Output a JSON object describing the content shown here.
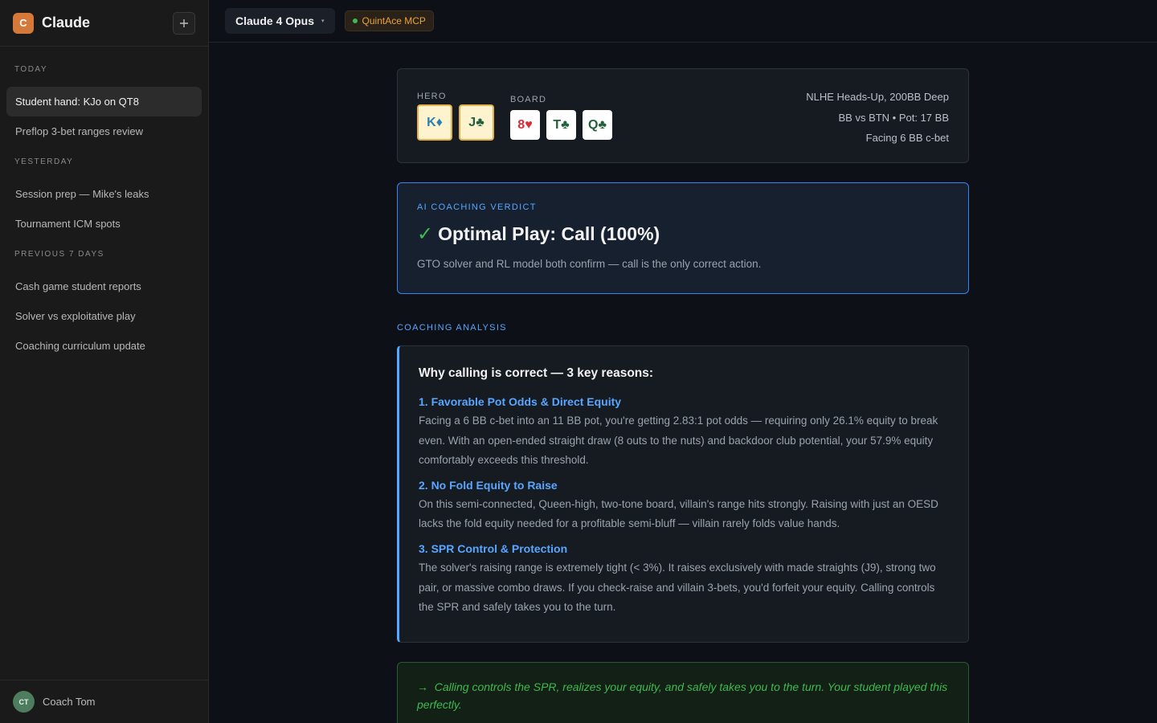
{
  "app": {
    "logo_letter": "C",
    "name": "Claude",
    "new_chat_icon": "plus-icon"
  },
  "sidebar": {
    "sections": [
      {
        "label": "TODAY",
        "items": [
          "Student hand: KJo on QT8",
          "Preflop 3-bet ranges review"
        ]
      },
      {
        "label": "YESTERDAY",
        "items": [
          "Session prep — Mike's leaks",
          "Tournament ICM spots"
        ]
      },
      {
        "label": "PREVIOUS 7 DAYS",
        "items": [
          "Cash game student reports",
          "Solver vs exploitative play",
          "Coaching curriculum update"
        ]
      }
    ],
    "active_item": "Student hand: KJo on QT8",
    "user": {
      "initials": "CT",
      "name": "Coach Tom"
    }
  },
  "topbar": {
    "model": "Claude 4 Opus",
    "caret": "▾",
    "mcp_badge": "QuintAce MCP",
    "mcp_status_color": "#3fb950"
  },
  "hand": {
    "hero_label": "HERO",
    "hero_cards": [
      {
        "rank": "K",
        "suit": "♦"
      },
      {
        "rank": "J",
        "suit": "♣"
      }
    ],
    "board_label": "BOARD",
    "board_cards": [
      {
        "rank": "8",
        "suit": "♥"
      },
      {
        "rank": "T",
        "suit": "♣"
      },
      {
        "rank": "Q",
        "suit": "♣"
      }
    ],
    "info": [
      "NLHE Heads-Up, 200BB Deep",
      "BB vs BTN • Pot: 17 BB",
      "Facing 6 BB c-bet"
    ]
  },
  "verdict": {
    "label": "AI COACHING VERDICT",
    "check": "✓",
    "title": "Optimal Play: Call (100%)",
    "subtitle": "GTO solver and RL model both confirm — call is the only correct action."
  },
  "analysis": {
    "section_label": "COACHING ANALYSIS",
    "heading": "Why calling is correct — 3 key reasons:",
    "reasons": [
      {
        "title": "1. Favorable Pot Odds & Direct Equity",
        "body": "Facing a 6 BB c-bet into an 11 BB pot, you're getting 2.83:1 pot odds — requiring only 26.1% equity to break even. With an open-ended straight draw (8 outs to the nuts) and backdoor club potential, your 57.9% equity comfortably exceeds this threshold."
      },
      {
        "title": "2. No Fold Equity to Raise",
        "body": "On this semi-connected, Queen-high, two-tone board, villain's range hits strongly. Raising with just an OESD lacks the fold equity needed for a profitable semi-bluff — villain rarely folds value hands."
      },
      {
        "title": "3. SPR Control & Protection",
        "body": "The solver's raising range is extremely tight (< 3%). It raises exclusively with made straights (J9), strong two pair, or massive combo draws. If you check-raise and villain 3-bets, you'd forfeit your equity. Calling controls the SPR and safely takes you to the turn."
      }
    ]
  },
  "conclusion": {
    "arrow": "→",
    "text": "Calling controls the SPR, realizes your equity, and safely takes you to the turn. Your student played this perfectly."
  },
  "colors": {
    "accent_blue": "#58a6ff",
    "accent_green": "#3fb950",
    "brand_orange": "#d4793a"
  }
}
